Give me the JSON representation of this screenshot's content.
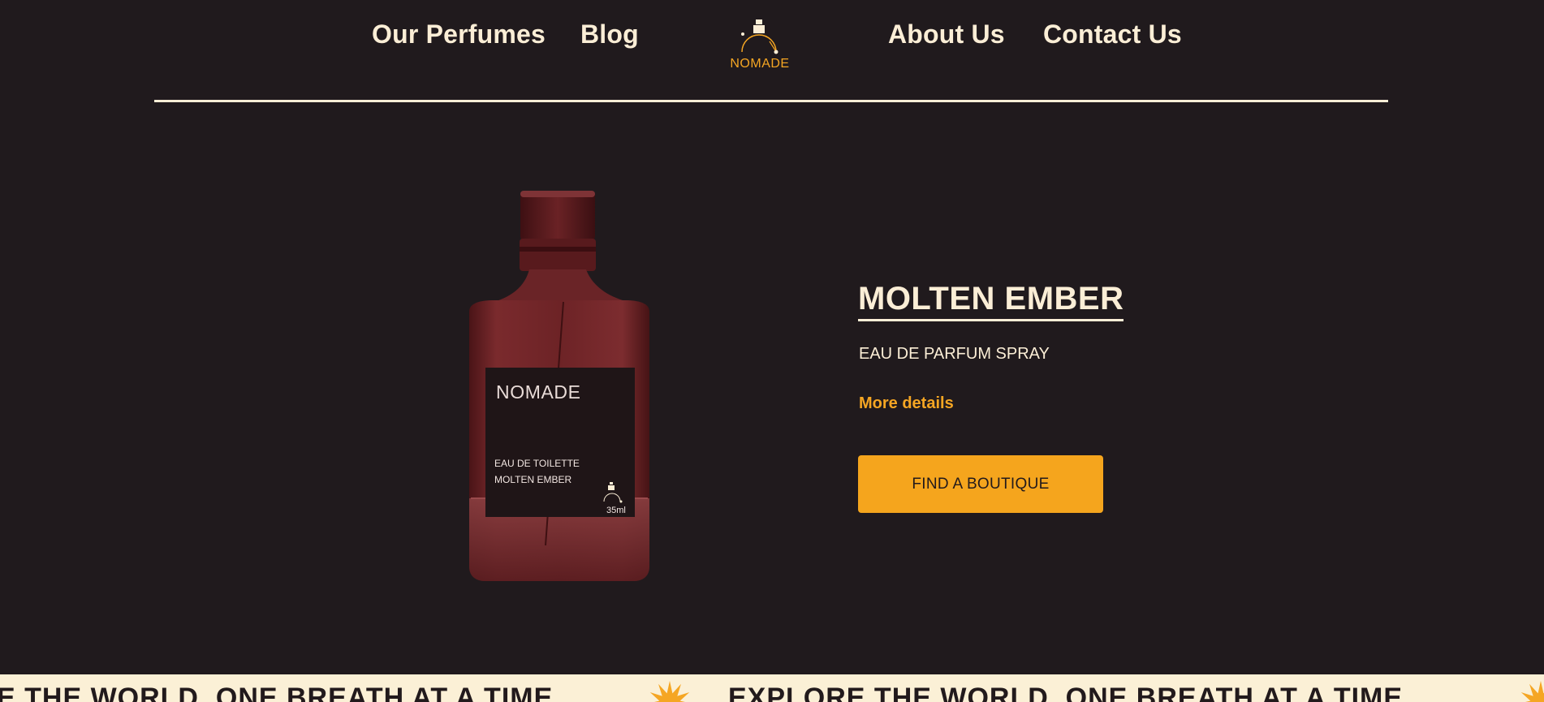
{
  "nav": {
    "items": [
      {
        "label": "Our Perfumes"
      },
      {
        "label": "Blog"
      },
      {
        "label": "About Us"
      },
      {
        "label": "Contact Us"
      }
    ],
    "logo_text": "NOMADE"
  },
  "bottle": {
    "brand": "NOMADE",
    "line1": "EAU DE TOILETTE",
    "line2": "MOLTEN EMBER",
    "size": "35ml"
  },
  "product": {
    "title": "MOLTEN EMBER",
    "subtitle": "EAU DE PARFUM SPRAY",
    "more_details": "More details",
    "cta": "FIND A BOUTIQUE"
  },
  "marquee": {
    "text_partial": "E THE WORLD, ONE BREATH AT A TIME",
    "text_full": "EXPLORE THE WORLD, ONE BREATH AT A TIME"
  },
  "colors": {
    "background": "#201a1d",
    "cream": "#fbeed6",
    "accent": "#f5a623",
    "bottle": "#6e2427"
  },
  "icons": {
    "logo": "perfume-bottle-arc-icon",
    "marquee_separator": "sun-icon"
  }
}
